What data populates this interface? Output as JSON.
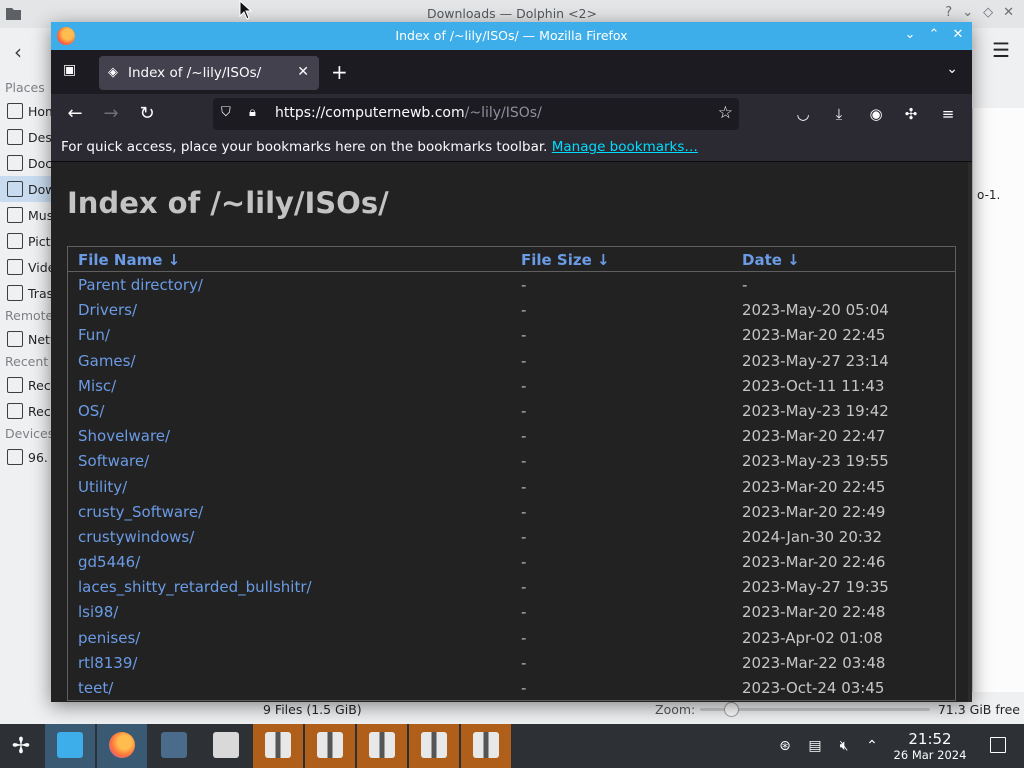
{
  "dolphin": {
    "title": "Downloads — Dolphin <2>",
    "places": [
      {
        "type": "section",
        "label": "Places"
      },
      {
        "type": "item",
        "label": "Home",
        "icon": "home-icon"
      },
      {
        "type": "item",
        "label": "Desktop",
        "icon": "desktop-icon"
      },
      {
        "type": "item",
        "label": "Documents",
        "icon": "documents-icon"
      },
      {
        "type": "item",
        "label": "Downloads",
        "icon": "downloads-icon",
        "active": true
      },
      {
        "type": "item",
        "label": "Music",
        "icon": "music-icon"
      },
      {
        "type": "item",
        "label": "Pictures",
        "icon": "pictures-icon"
      },
      {
        "type": "item",
        "label": "Videos",
        "icon": "videos-icon"
      },
      {
        "type": "item",
        "label": "Trash",
        "icon": "trash-icon"
      },
      {
        "type": "section",
        "label": "Remote"
      },
      {
        "type": "item",
        "label": "Network",
        "icon": "network-icon"
      },
      {
        "type": "section",
        "label": "Recent"
      },
      {
        "type": "item",
        "label": "Recent Files",
        "icon": "recent-files-icon"
      },
      {
        "type": "item",
        "label": "Recent Locations",
        "icon": "recent-locations-icon"
      },
      {
        "type": "section",
        "label": "Devices"
      },
      {
        "type": "item",
        "label": "96.",
        "icon": "drive-icon"
      }
    ],
    "content_fragment": "o-1.",
    "status": {
      "files": "9 Files (1.5 GiB)",
      "zoom_label": "Zoom:",
      "free": "71.3 GiB free"
    }
  },
  "firefox": {
    "window_title": "Index of /~lily/ISOs/ — Mozilla Firefox",
    "tab_title": "Index of /~lily/ISOs/",
    "url_host": "https://computernewb.com",
    "url_path": "/~lily/ISOs/",
    "bookmarks_notice": "For quick access, place your bookmarks here on the bookmarks toolbar.",
    "bookmarks_link": "Manage bookmarks…"
  },
  "page": {
    "heading": "Index of /~lily/ISOs/",
    "columns": {
      "name": "File Name ↓",
      "size": "File Size ↓",
      "date": "Date ↓"
    },
    "rows": [
      {
        "name": "Parent directory/",
        "size": "-",
        "date": "-"
      },
      {
        "name": "Drivers/",
        "size": "-",
        "date": "2023-May-20 05:04"
      },
      {
        "name": "Fun/",
        "size": "-",
        "date": "2023-Mar-20 22:45"
      },
      {
        "name": "Games/",
        "size": "-",
        "date": "2023-May-27 23:14"
      },
      {
        "name": "Misc/",
        "size": "-",
        "date": "2023-Oct-11 11:43"
      },
      {
        "name": "OS/",
        "size": "-",
        "date": "2023-May-23 19:42"
      },
      {
        "name": "Shovelware/",
        "size": "-",
        "date": "2023-Mar-20 22:47"
      },
      {
        "name": "Software/",
        "size": "-",
        "date": "2023-May-23 19:55"
      },
      {
        "name": "Utility/",
        "size": "-",
        "date": "2023-Mar-20 22:45"
      },
      {
        "name": "crusty_Software/",
        "size": "-",
        "date": "2023-Mar-20 22:49"
      },
      {
        "name": "crustywindows/",
        "size": "-",
        "date": "2024-Jan-30 20:32"
      },
      {
        "name": "gd5446/",
        "size": "-",
        "date": "2023-Mar-20 22:46"
      },
      {
        "name": "laces_shitty_retarded_bullshitr/",
        "size": "-",
        "date": "2023-May-27 19:35"
      },
      {
        "name": "lsi98/",
        "size": "-",
        "date": "2023-Mar-20 22:48"
      },
      {
        "name": "penises/",
        "size": "-",
        "date": "2023-Apr-02 01:08"
      },
      {
        "name": "rtl8139/",
        "size": "-",
        "date": "2023-Mar-22 03:48"
      },
      {
        "name": "teet/",
        "size": "-",
        "date": "2023-Oct-24 03:45"
      }
    ]
  },
  "taskbar": {
    "time": "21:52",
    "date": "26 Mar 2024",
    "tasks": [
      {
        "name": "dolphin-task",
        "icon": "folder-icon",
        "state": "active",
        "color": "#3daee9"
      },
      {
        "name": "firefox-task",
        "icon": "firefox-icon",
        "state": "active",
        "color": "#ff7139"
      },
      {
        "name": "settings-task",
        "icon": "settings-sliders-icon",
        "state": "normal",
        "color": "#4a6b8a"
      },
      {
        "name": "app-task",
        "icon": "app-icon",
        "state": "normal",
        "color": "#d9d9d9"
      },
      {
        "name": "archive-task-1",
        "icon": "archive-icon",
        "state": "orange",
        "color": "#e8e8e8"
      },
      {
        "name": "archive-task-2",
        "icon": "archive-icon",
        "state": "orange",
        "color": "#e8e8e8"
      },
      {
        "name": "archive-task-3",
        "icon": "archive-icon",
        "state": "orange",
        "color": "#e8e8e8"
      },
      {
        "name": "archive-task-4",
        "icon": "archive-icon",
        "state": "orange",
        "color": "#e8e8e8"
      },
      {
        "name": "archive-task-5",
        "icon": "archive-icon",
        "state": "orange",
        "color": "#e8e8e8"
      }
    ]
  },
  "colors": {
    "kde_accent": "#3daee9",
    "firefox_dark": "#1c1b22",
    "page_bg": "#222222",
    "link": "#6b9be5",
    "taskbar": "#2d3136"
  }
}
